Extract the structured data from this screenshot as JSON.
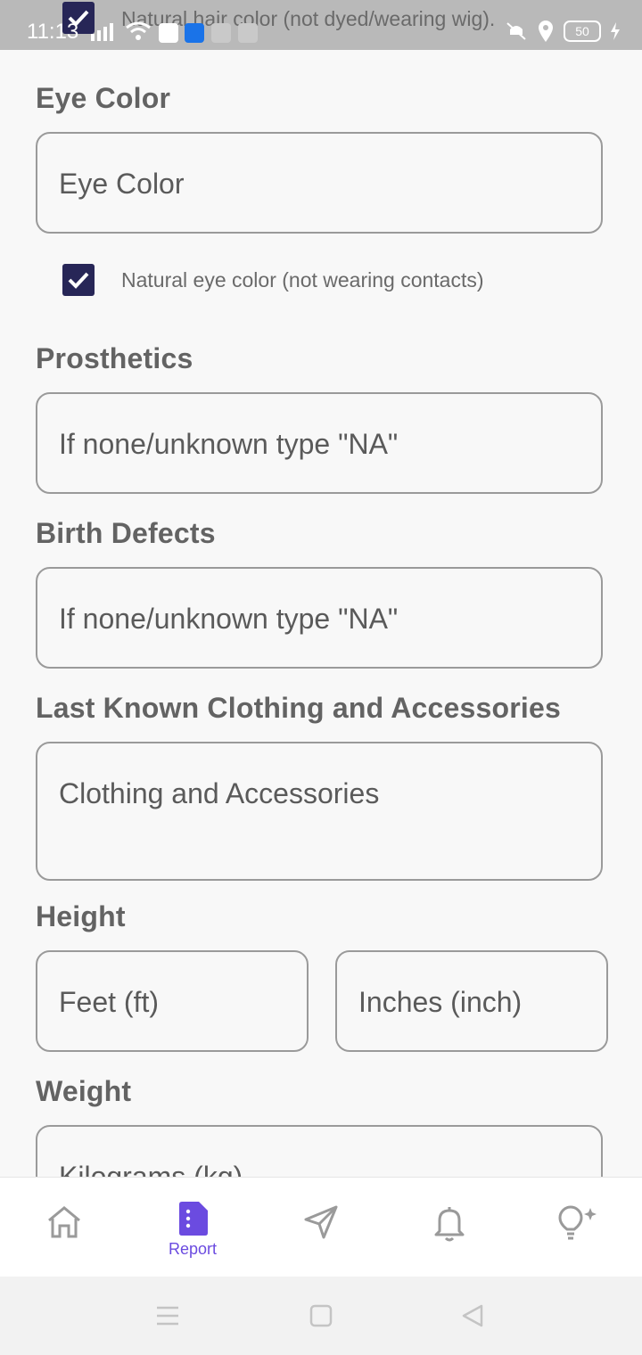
{
  "status_bar": {
    "time": "11:13",
    "battery": "50",
    "overlay_checkbox_text": "Natural hair color (not dyed/wearing wig)."
  },
  "form": {
    "eye_color": {
      "label": "Eye Color",
      "placeholder": "Eye Color",
      "checkbox_label": "Natural eye color (not wearing contacts)",
      "checked": true
    },
    "prosthetics": {
      "label": "Prosthetics",
      "placeholder": "If none/unknown type \"NA\""
    },
    "birth_defects": {
      "label": "Birth Defects",
      "placeholder": "If none/unknown type \"NA\""
    },
    "clothing": {
      "label": "Last Known Clothing and Accessories",
      "placeholder": "Clothing and Accessories"
    },
    "height": {
      "label": "Height",
      "feet_placeholder": "Feet (ft)",
      "inches_placeholder": "Inches (inch)"
    },
    "weight": {
      "label": "Weight",
      "placeholder": "Kilograms (kg)"
    }
  },
  "bottom_nav": {
    "items": [
      {
        "icon": "home-icon",
        "label": ""
      },
      {
        "icon": "report-icon",
        "label": "Report",
        "active": true
      },
      {
        "icon": "send-icon",
        "label": ""
      },
      {
        "icon": "bell-icon",
        "label": ""
      },
      {
        "icon": "lightbulb-icon",
        "label": ""
      }
    ]
  },
  "colors": {
    "accent": "#6b4be0",
    "checkbox": "#272657",
    "status_bar": "#b9b9b9"
  }
}
